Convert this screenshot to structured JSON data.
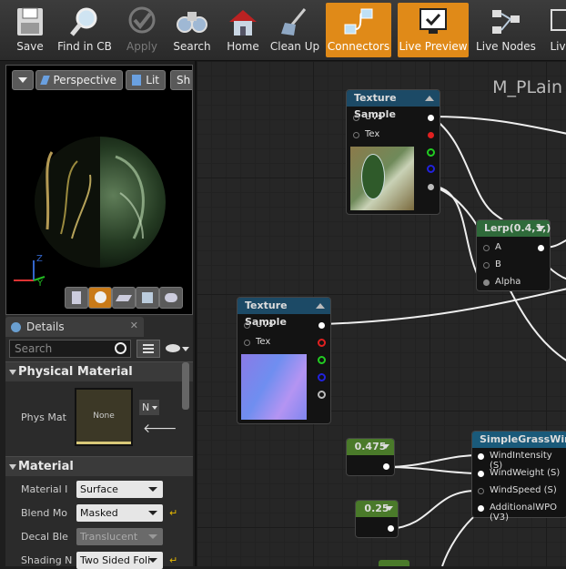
{
  "toolbar": {
    "buttons": [
      {
        "label": "Save",
        "icon": "floppy-disk-icon",
        "state": "normal"
      },
      {
        "label": "Find in CB",
        "icon": "magnifier-icon",
        "state": "normal"
      },
      {
        "label": "Apply",
        "icon": "checkmark-icon",
        "state": "disabled"
      },
      {
        "label": "Search",
        "icon": "binoculars-icon",
        "state": "normal"
      },
      {
        "label": "Home",
        "icon": "house-icon",
        "state": "normal"
      },
      {
        "label": "Clean Up",
        "icon": "broom-icon",
        "state": "normal"
      },
      {
        "label": "Connectors",
        "icon": "connectors-icon",
        "state": "active"
      },
      {
        "label": "Live Preview",
        "icon": "monitor-icon",
        "state": "active"
      },
      {
        "label": "Live Nodes",
        "icon": "node-graph-icon",
        "state": "normal"
      },
      {
        "label": "Liv",
        "icon": "live-update-icon",
        "state": "normal"
      }
    ]
  },
  "viewport": {
    "perspective_label": "Perspective",
    "lit_label": "Lit",
    "show_label": "Sh",
    "axis_z": "Z",
    "axis_y": "Y"
  },
  "details": {
    "tab_label": "Details",
    "search_placeholder": "Search",
    "physical_section": "Physical Material",
    "phys_mat_label": "Phys Mat",
    "phys_mat_thumb": "None",
    "phys_mat_dropdown": "N",
    "material_section": "Material",
    "props": [
      {
        "label": "Material I",
        "value": "Surface",
        "enabled": true
      },
      {
        "label": "Blend Mo",
        "value": "Masked",
        "enabled": true
      },
      {
        "label": "Decal Ble",
        "value": "Translucent",
        "enabled": false
      },
      {
        "label": "Shading N",
        "value": "Two Sided Foli",
        "enabled": true
      }
    ]
  },
  "graph": {
    "title": "M_PLain",
    "nodes": {
      "tex1": {
        "title": "Texture Sample",
        "in1": "UVs",
        "in2": "Tex"
      },
      "lerp": {
        "title": "Lerp(0.4,1,)",
        "in1": "A",
        "in2": "B",
        "in3": "Alpha"
      },
      "tex2": {
        "title": "Texture Sample",
        "in1": "UVs",
        "in2": "Tex"
      },
      "c475": {
        "title": "0.475"
      },
      "c25": {
        "title": "0.25"
      },
      "wind": {
        "title": "SimpleGrassWind",
        "in1": "WindIntensity (S)",
        "in2": "WindWeight (S)",
        "in3": "WindSpeed (S)",
        "in4": "AdditionalWPO (V3)"
      }
    }
  },
  "colors": {
    "accent": "#e08a18",
    "texture_head": "#1c4a66",
    "lerp_head": "#2f6a3a",
    "const_head": "#4a7a2a",
    "wind_head": "#1a5a7a"
  }
}
